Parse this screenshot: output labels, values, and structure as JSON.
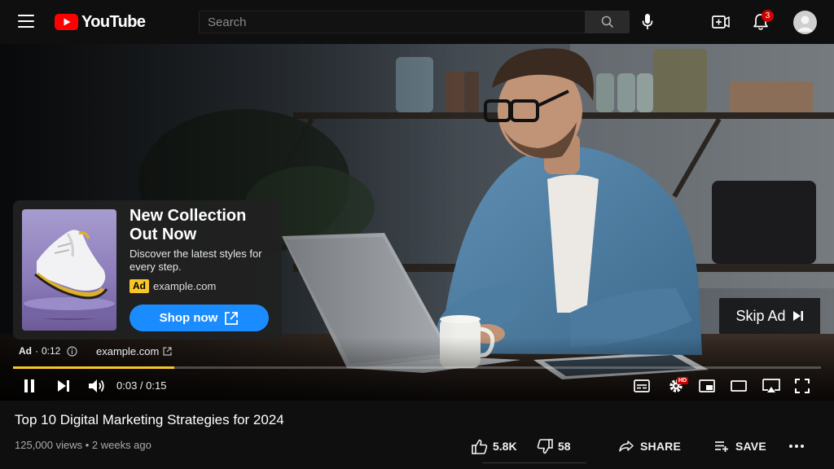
{
  "header": {
    "logo_text": "YouTube",
    "search_placeholder": "Search",
    "notifications_count": "3"
  },
  "ad": {
    "title": "New Collection Out Now",
    "description": "Discover the latest styles for every step.",
    "chip": "Ad",
    "domain": "example.com",
    "cta_label": "Shop now",
    "info_label": "Ad",
    "info_separator": "·",
    "info_time": "0:12",
    "info_domain": "example.com",
    "skip_label": "Skip Ad",
    "accent_color": "#f9c627",
    "cta_color": "#1a8cff"
  },
  "player": {
    "time_display": "0:03 / 0:15",
    "progress": 0.2,
    "hd_badge": "HD"
  },
  "video": {
    "title": "Top 10 Digital Marketing Strategies for 2024",
    "meta": "125,000 views • 2 weeks ago",
    "likes": "5.8K",
    "dislikes": "58",
    "share_label": "SHARE",
    "save_label": "SAVE"
  }
}
